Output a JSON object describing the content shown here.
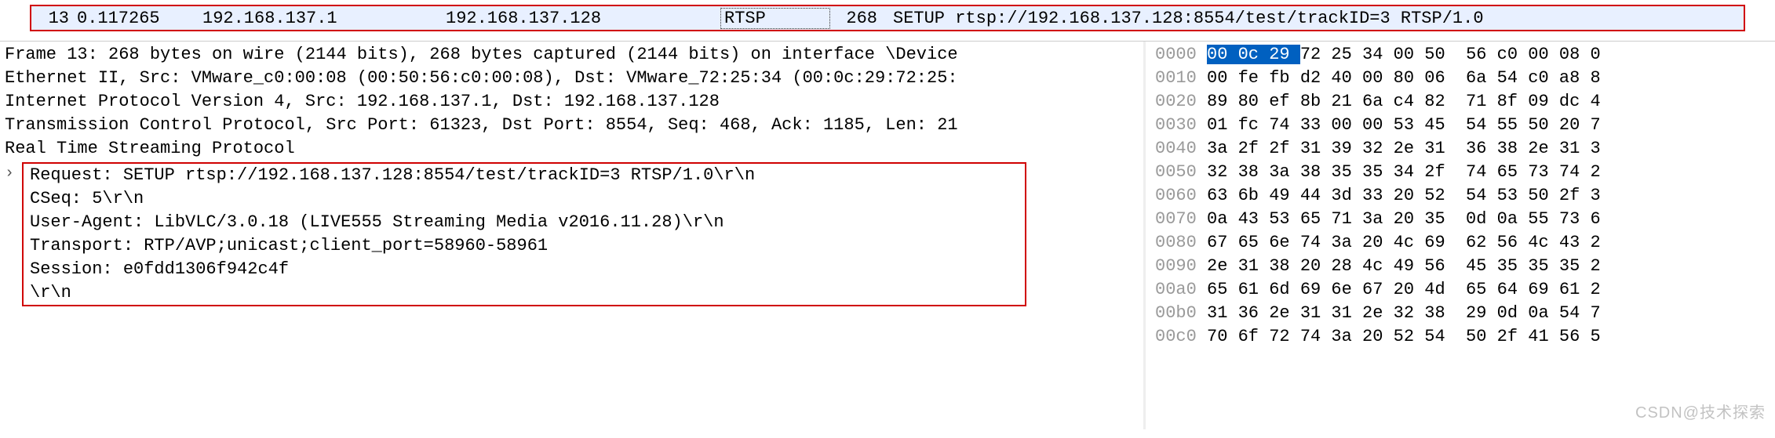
{
  "packet_list": {
    "row": {
      "no": "13",
      "time": "0.117265",
      "source": "192.168.137.1",
      "destination": "192.168.137.128",
      "protocol": "RTSP",
      "length": "268",
      "info": "SETUP rtsp://192.168.137.128:8554/test/trackID=3 RTSP/1.0"
    }
  },
  "details": {
    "frame": "Frame 13: 268 bytes on wire (2144 bits), 268 bytes captured (2144 bits) on interface \\Device",
    "ethernet": "Ethernet II, Src: VMware_c0:00:08 (00:50:56:c0:00:08), Dst: VMware_72:25:34 (00:0c:29:72:25:",
    "ip": "Internet Protocol Version 4, Src: 192.168.137.1, Dst: 192.168.137.128",
    "tcp": "Transmission Control Protocol, Src Port: 61323, Dst Port: 8554, Seq: 468, Ack: 1185, Len: 21",
    "rtsp_header": "Real Time Streaming Protocol",
    "rtsp": {
      "request": "Request: SETUP rtsp://192.168.137.128:8554/test/trackID=3 RTSP/1.0\\r\\n",
      "cseq": "CSeq: 5\\r\\n",
      "user_agent": "User-Agent: LibVLC/3.0.18 (LIVE555 Streaming Media v2016.11.28)\\r\\n",
      "transport": "Transport: RTP/AVP;unicast;client_port=58960-58961",
      "session": "Session: e0fdd1306f942c4f",
      "blank": "\\r\\n"
    }
  },
  "hex": {
    "selected_bytes": "00 0c 29",
    "rows": [
      {
        "offset": "0000",
        "pre_sel": "",
        "sel": "00 0c 29 ",
        "post_sel": "72 25 34 00 50  56 c0 00 08 0"
      },
      {
        "offset": "0010",
        "bytes": "00 fe fb d2 40 00 80 06  6a 54 c0 a8 8"
      },
      {
        "offset": "0020",
        "bytes": "89 80 ef 8b 21 6a c4 82  71 8f 09 dc 4"
      },
      {
        "offset": "0030",
        "bytes": "01 fc 74 33 00 00 53 45  54 55 50 20 7"
      },
      {
        "offset": "0040",
        "bytes": "3a 2f 2f 31 39 32 2e 31  36 38 2e 31 3"
      },
      {
        "offset": "0050",
        "bytes": "32 38 3a 38 35 35 34 2f  74 65 73 74 2"
      },
      {
        "offset": "0060",
        "bytes": "63 6b 49 44 3d 33 20 52  54 53 50 2f 3"
      },
      {
        "offset": "0070",
        "bytes": "0a 43 53 65 71 3a 20 35  0d 0a 55 73 6"
      },
      {
        "offset": "0080",
        "bytes": "67 65 6e 74 3a 20 4c 69  62 56 4c 43 2"
      },
      {
        "offset": "0090",
        "bytes": "2e 31 38 20 28 4c 49 56  45 35 35 35 2"
      },
      {
        "offset": "00a0",
        "bytes": "65 61 6d 69 6e 67 20 4d  65 64 69 61 2"
      },
      {
        "offset": "00b0",
        "bytes": "31 36 2e 31 31 2e 32 38  29 0d 0a 54 7"
      },
      {
        "offset": "00c0",
        "bytes": "70 6f 72 74 3a 20 52 54  50 2f 41 56 5"
      }
    ]
  },
  "watermark": "CSDN@技术探索"
}
